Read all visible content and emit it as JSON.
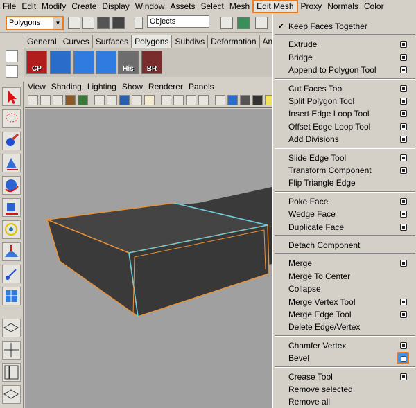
{
  "menubar": {
    "items": [
      "File",
      "Edit",
      "Modify",
      "Create",
      "Display",
      "Window",
      "Assets",
      "Select",
      "Mesh",
      "Edit Mesh",
      "Proxy",
      "Normals",
      "Color"
    ]
  },
  "statusline": {
    "mode": "Polygons",
    "selection_field": "Objects"
  },
  "shelf": {
    "tabs": [
      "General",
      "Curves",
      "Surfaces",
      "Polygons",
      "Subdivs",
      "Deformation",
      "Animation"
    ],
    "buttons": [
      {
        "label": "CP",
        "icon": "cp-icon"
      },
      {
        "label": "",
        "icon": "cube-icon"
      },
      {
        "label": "",
        "icon": "grid-icon"
      },
      {
        "label": "",
        "icon": "grid-icon-2"
      },
      {
        "label": "His",
        "icon": "history-icon"
      },
      {
        "label": "BR",
        "icon": "br-icon"
      }
    ]
  },
  "panel": {
    "menu": [
      "View",
      "Shading",
      "Lighting",
      "Show",
      "Renderer",
      "Panels"
    ]
  },
  "dropdown": {
    "title": "Edit Mesh",
    "items": [
      {
        "label": "Keep Faces Together",
        "checked": true,
        "option": false
      },
      {
        "sep": true
      },
      {
        "label": "Extrude",
        "option": true
      },
      {
        "label": "Bridge",
        "option": true
      },
      {
        "label": "Append to Polygon Tool",
        "option": true
      },
      {
        "sep": true
      },
      {
        "label": "Cut Faces Tool",
        "option": true
      },
      {
        "label": "Split Polygon Tool",
        "option": true
      },
      {
        "label": "Insert Edge Loop Tool",
        "option": true
      },
      {
        "label": "Offset Edge Loop Tool",
        "option": true
      },
      {
        "label": "Add Divisions",
        "option": true
      },
      {
        "sep": true
      },
      {
        "label": "Slide Edge Tool",
        "option": true
      },
      {
        "label": "Transform Component",
        "option": true
      },
      {
        "label": "Flip Triangle Edge",
        "option": false
      },
      {
        "sep": true
      },
      {
        "label": "Poke Face",
        "option": true
      },
      {
        "label": "Wedge Face",
        "option": true
      },
      {
        "label": "Duplicate Face",
        "option": true
      },
      {
        "sep": true
      },
      {
        "label": "Detach Component",
        "option": false
      },
      {
        "sep": true
      },
      {
        "label": "Merge",
        "option": true
      },
      {
        "label": "Merge To Center",
        "option": false
      },
      {
        "label": "Collapse",
        "option": false
      },
      {
        "label": "Merge Vertex Tool",
        "option": true
      },
      {
        "label": "Merge Edge Tool",
        "option": true
      },
      {
        "label": "Delete Edge/Vertex",
        "option": false
      },
      {
        "sep": true
      },
      {
        "label": "Chamfer Vertex",
        "option": true
      },
      {
        "label": "Bevel",
        "option": true,
        "highlight": true
      },
      {
        "sep": true
      },
      {
        "label": "Crease Tool",
        "option": true
      },
      {
        "label": "Remove selected",
        "option": false
      },
      {
        "label": "Remove all",
        "option": false
      }
    ]
  },
  "colors": {
    "ui_bg": "#d4d0c8",
    "highlight": "#e87c1e",
    "viewport_bg": "#a0a0a0",
    "mesh": "#3d3d3d",
    "mesh_edge_selected": "#5fd0e8"
  }
}
